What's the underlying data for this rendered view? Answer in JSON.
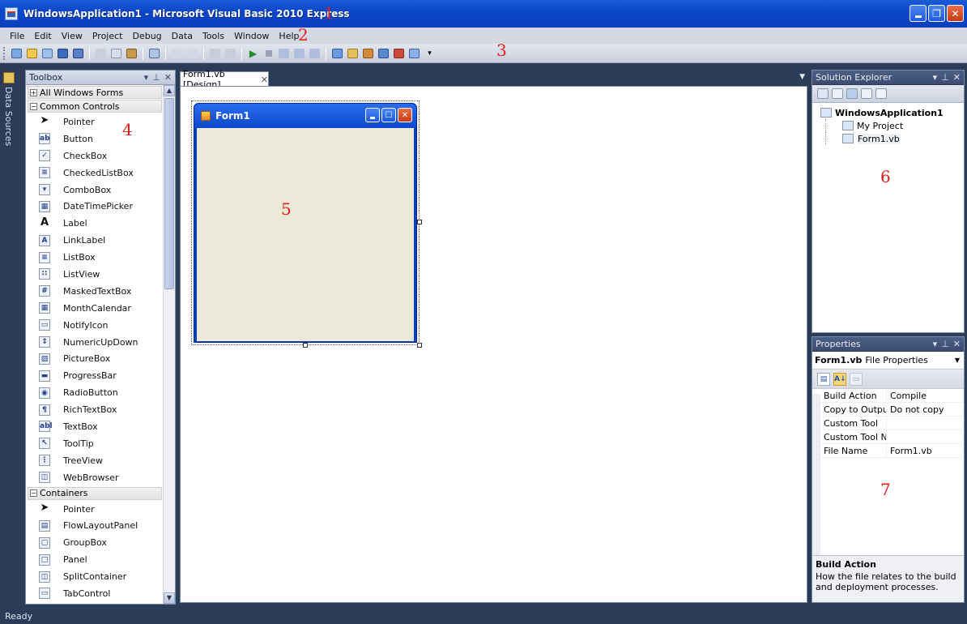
{
  "titlebar": {
    "title": "WindowsApplication1 - Microsoft Visual Basic 2010 Express"
  },
  "menu": [
    "File",
    "Edit",
    "View",
    "Project",
    "Debug",
    "Data",
    "Tools",
    "Window",
    "Help"
  ],
  "annotations": [
    "1",
    "2",
    "3",
    "4",
    "5",
    "6",
    "7"
  ],
  "datasources": {
    "label": "Data Sources"
  },
  "toolbox": {
    "title": "Toolbox",
    "cat_all": "All Windows Forms",
    "cat_common": "Common Controls",
    "common": [
      {
        "label": "Pointer",
        "icon": "pointer-icon"
      },
      {
        "label": "Button",
        "icon": "button-icon"
      },
      {
        "label": "CheckBox",
        "icon": "checkbox-icon"
      },
      {
        "label": "CheckedListBox",
        "icon": "checkedlistbox-icon"
      },
      {
        "label": "ComboBox",
        "icon": "combobox-icon"
      },
      {
        "label": "DateTimePicker",
        "icon": "datetimepicker-icon"
      },
      {
        "label": "Label",
        "icon": "label-icon"
      },
      {
        "label": "LinkLabel",
        "icon": "linklabel-icon"
      },
      {
        "label": "ListBox",
        "icon": "listbox-icon"
      },
      {
        "label": "ListView",
        "icon": "listview-icon"
      },
      {
        "label": "MaskedTextBox",
        "icon": "maskedtextbox-icon"
      },
      {
        "label": "MonthCalendar",
        "icon": "monthcalendar-icon"
      },
      {
        "label": "NotifyIcon",
        "icon": "notifyicon-icon"
      },
      {
        "label": "NumericUpDown",
        "icon": "numericupdown-icon"
      },
      {
        "label": "PictureBox",
        "icon": "picturebox-icon"
      },
      {
        "label": "ProgressBar",
        "icon": "progressbar-icon"
      },
      {
        "label": "RadioButton",
        "icon": "radiobutton-icon"
      },
      {
        "label": "RichTextBox",
        "icon": "richtextbox-icon"
      },
      {
        "label": "TextBox",
        "icon": "textbox-icon"
      },
      {
        "label": "ToolTip",
        "icon": "tooltip-icon"
      },
      {
        "label": "TreeView",
        "icon": "treeview-icon"
      },
      {
        "label": "WebBrowser",
        "icon": "webbrowser-icon"
      }
    ],
    "cat_containers": "Containers",
    "containers": [
      {
        "label": "Pointer",
        "icon": "pointer-icon"
      },
      {
        "label": "FlowLayoutPanel",
        "icon": "flowlayoutpanel-icon"
      },
      {
        "label": "GroupBox",
        "icon": "groupbox-icon"
      },
      {
        "label": "Panel",
        "icon": "panel-icon"
      },
      {
        "label": "SplitContainer",
        "icon": "splitcontainer-icon"
      },
      {
        "label": "TabControl",
        "icon": "tabcontrol-icon"
      }
    ]
  },
  "doc": {
    "tab_label": "Form1.vb [Design]",
    "form_title": "Form1"
  },
  "solution": {
    "title": "Solution Explorer",
    "root": "WindowsApplication1",
    "items": [
      "My Project",
      "Form1.vb"
    ]
  },
  "properties": {
    "title": "Properties",
    "object_name": "Form1.vb",
    "object_type": "File Properties",
    "rows": [
      {
        "name": "Build Action",
        "value": "Compile"
      },
      {
        "name": "Copy to Output I",
        "value": "Do not copy"
      },
      {
        "name": "Custom Tool",
        "value": ""
      },
      {
        "name": "Custom Tool Nan",
        "value": ""
      },
      {
        "name": "File Name",
        "value": "Form1.vb"
      }
    ],
    "desc_title": "Build Action",
    "desc_text": "How the file relates to the build and deployment processes."
  },
  "status": {
    "text": "Ready"
  },
  "colors": {
    "titlebar": "#0b47c9",
    "annotation": "#e0201a",
    "ide_background": "#2b3c59",
    "form_body": "#ece9d8"
  }
}
